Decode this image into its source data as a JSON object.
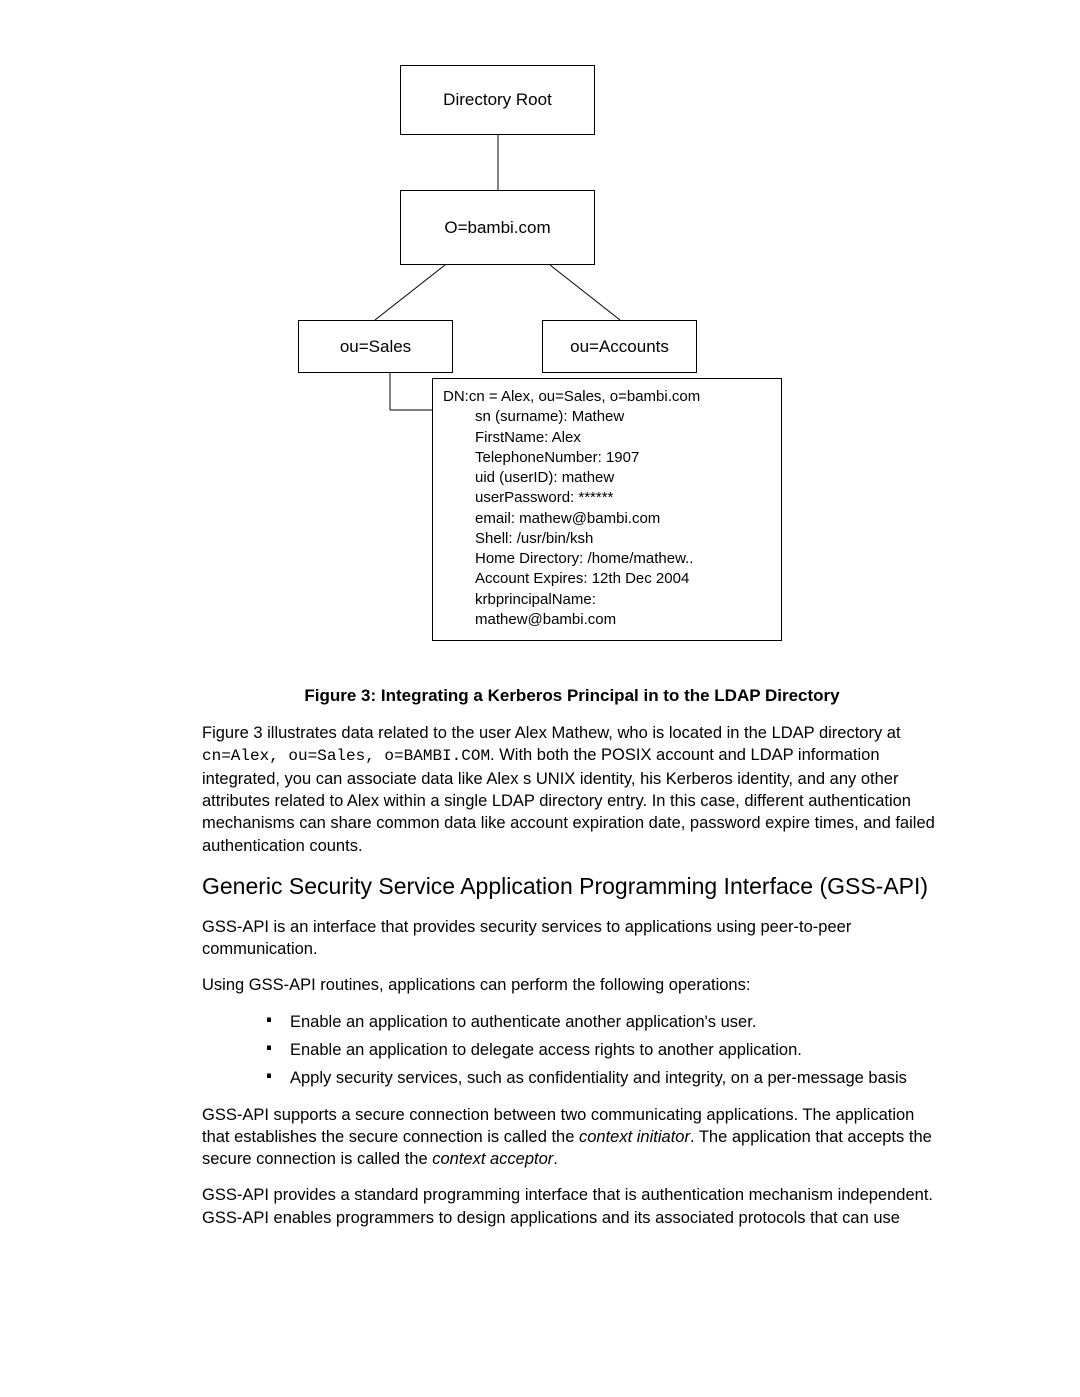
{
  "diagram": {
    "root": "Directory Root",
    "org": "O=bambi.com",
    "ou_left": "ou=Sales",
    "ou_right": "ou=Accounts",
    "leaf_dn": "DN:cn = Alex, ou=Sales, o=bambi.com",
    "leaf_attrs": [
      "sn (surname): Mathew",
      "FirstName: Alex",
      "TelephoneNumber: 1907",
      "uid (userID): mathew",
      "userPassword: ******",
      "email: mathew@bambi.com",
      "Shell:  /usr/bin/ksh",
      "Home Directory: /home/mathew..",
      "Account Expires: 12th Dec 2004",
      "krbprincipalName:",
      "mathew@bambi.com"
    ]
  },
  "caption": "Figure 3: Integrating a Kerberos Principal in to the LDAP Directory",
  "p1a": "Figure 3 illustrates data related to the user Alex Mathew, who is located in the LDAP directory at ",
  "p1code": "cn=Alex, ou=Sales, o=BAMBI.COM",
  "p1b": ". With both the POSIX account and LDAP information integrated, you can associate data like Alex s UNIX identity, his Kerberos identity, and any other attributes related to Alex within a single LDAP directory entry. In this case, different authentication mechanisms can share common data like account expiration date, password expire times, and failed authentication counts.",
  "h2": "Generic Security Service Application Programming Interface (GSS-API)",
  "p2": "GSS-API is an interface that provides security services to applications using peer-to-peer communication.",
  "p3": "Using GSS-API routines, applications can perform the following operations:",
  "bullets": [
    "Enable an application to authenticate another application's user.",
    "Enable an application to delegate access rights to another application.",
    "Apply security services, such as confidentiality and integrity, on a per-message basis"
  ],
  "p4a": "GSS-API supports a secure connection between two communicating applications. The application that establishes the secure connection is called the ",
  "p4i1": "context initiator",
  "p4b": ". The application that accepts the secure connection is called the ",
  "p4i2": "context acceptor",
  "p4c": ".",
  "p5": "GSS-API provides a standard programming interface that is authentication mechanism independent. GSS-API enables programmers to design applications and its associated protocols that can use"
}
